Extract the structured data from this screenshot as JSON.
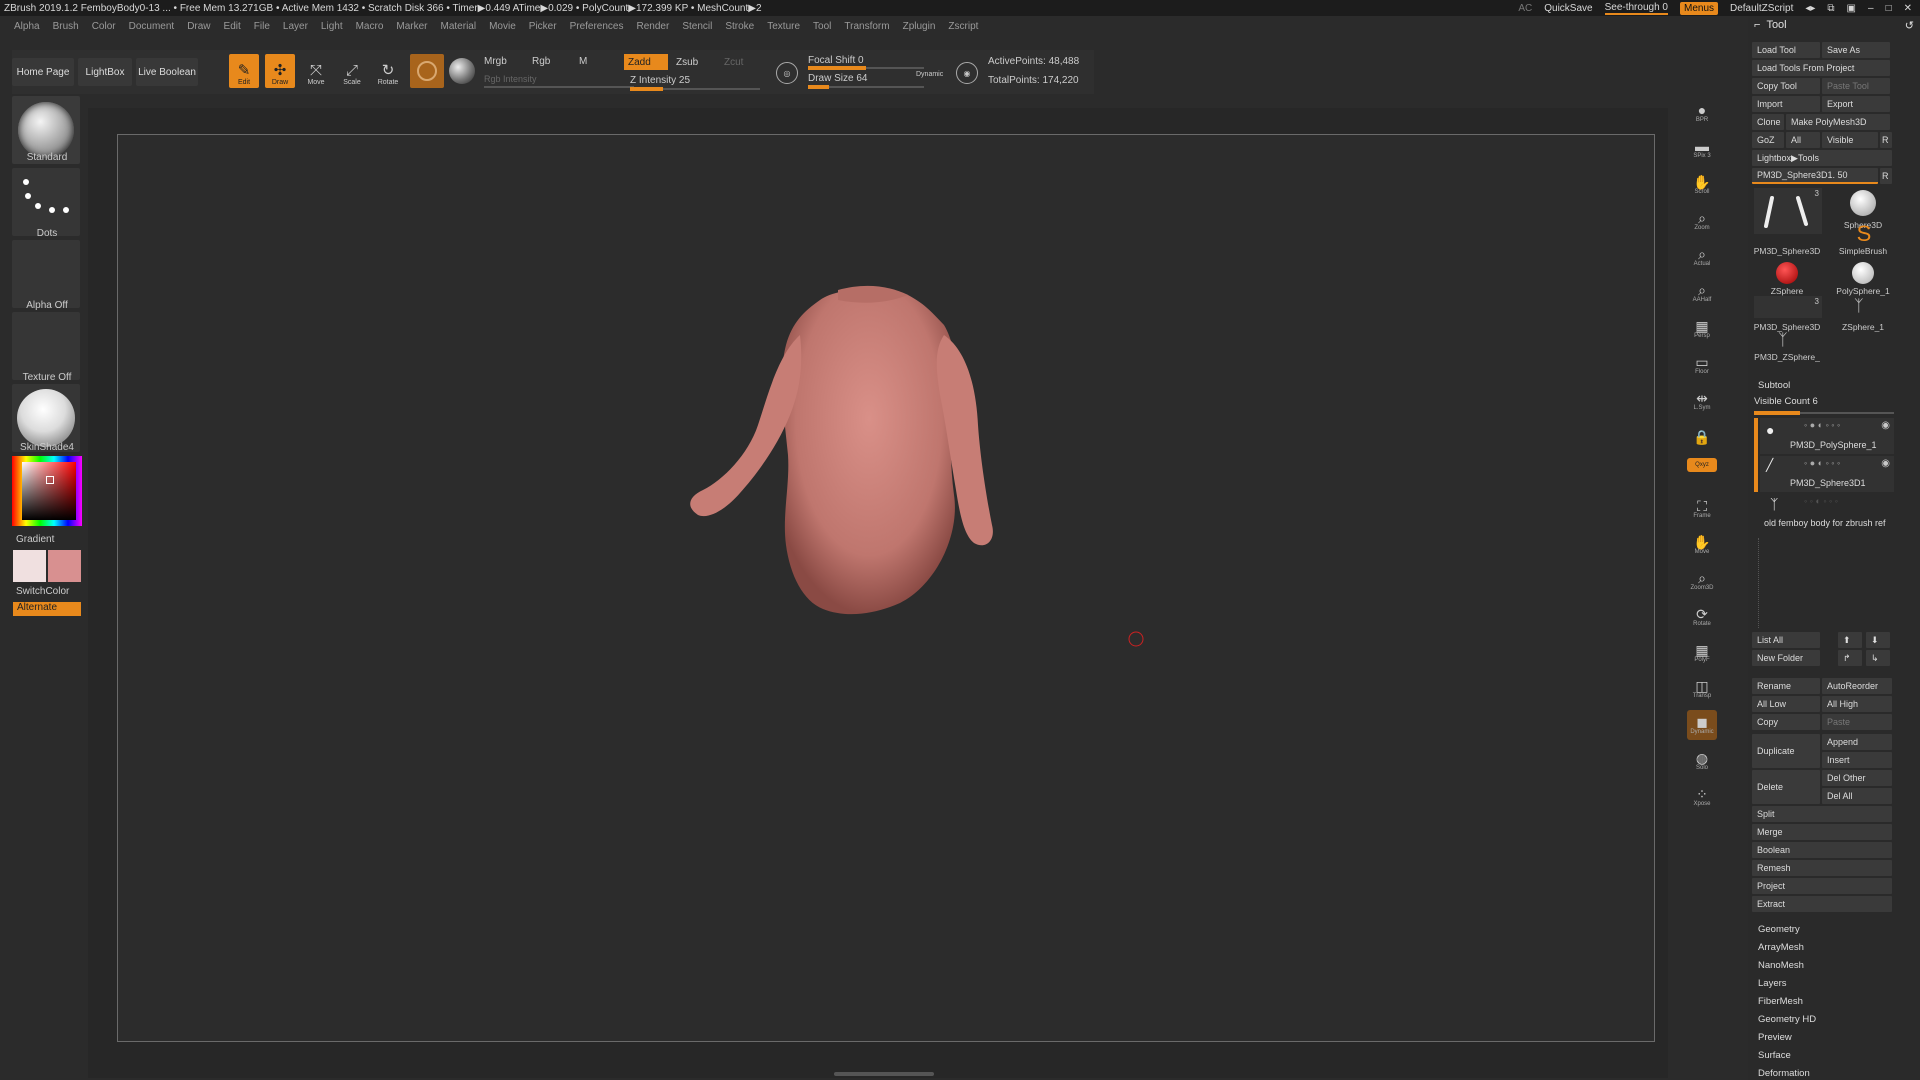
{
  "titlebar": {
    "text": "ZBrush 2019.1.2   FemboyBody0-13   ...  • Free Mem 13.271GB • Active Mem 1432 • Scratch Disk 366 • Timer▶0.449 ATime▶0.029 • PolyCount▶172.399 KP • MeshCount▶2",
    "ac": "AC",
    "quicksave": "QuickSave",
    "seethrough": "See-through  0",
    "menus": "Menus",
    "script": "DefaultZScript"
  },
  "menubar": [
    "Alpha",
    "Brush",
    "Color",
    "Document",
    "Draw",
    "Edit",
    "File",
    "Layer",
    "Light",
    "Macro",
    "Marker",
    "Material",
    "Movie",
    "Picker",
    "Preferences",
    "Render",
    "Stencil",
    "Stroke",
    "Texture",
    "Tool",
    "Transform",
    "Zplugin",
    "Zscript"
  ],
  "toolbar": {
    "home": "Home Page",
    "lightbox": "LightBox",
    "liveboolean": "Live Boolean",
    "edit": "Edit",
    "draw": "Draw",
    "move": "Move",
    "scale": "Scale",
    "rotate": "Rotate",
    "mrgb": "Mrgb",
    "rgb": "Rgb",
    "m": "M",
    "rgb_intensity": "Rgb Intensity",
    "zadd": "Zadd",
    "zsub": "Zsub",
    "zcut": "Zcut",
    "z_intensity": "Z Intensity 25",
    "focal_shift": "Focal Shift 0",
    "draw_size": "Draw Size 64",
    "dynamic": "Dynamic",
    "active_points": "ActivePoints: 48,488",
    "total_points": "TotalPoints: 174,220",
    "z_intensity_level": 0.25,
    "focal_level": 0.5,
    "drawsize_level": 0.18
  },
  "leftpanel": {
    "brush": "Standard",
    "stroke": "Dots",
    "alpha": "Alpha Off",
    "texture": "Texture Off",
    "material": "SkinShade4",
    "gradient": "Gradient",
    "switchcolor": "SwitchColor",
    "alternate": "Alternate"
  },
  "rightstrip": [
    {
      "n": "bpr",
      "l": "BPR"
    },
    {
      "n": "spix",
      "l": "SPix 3"
    },
    {
      "n": "scroll",
      "l": "Scroll"
    },
    {
      "n": "zoom",
      "l": "Zoom"
    },
    {
      "n": "actual",
      "l": "Actual"
    },
    {
      "n": "aahalf",
      "l": "AAHalf"
    },
    {
      "n": "persp",
      "l": "Persp"
    },
    {
      "n": "floor",
      "l": "Floor"
    },
    {
      "n": "lsym",
      "l": "L.Sym"
    },
    {
      "n": "lock",
      "l": ""
    },
    {
      "n": "xyz",
      "l": "Qxyz"
    },
    {
      "n": "frame",
      "l": "Frame"
    },
    {
      "n": "move",
      "l": "Move"
    },
    {
      "n": "zoom3d",
      "l": "Zoom3D"
    },
    {
      "n": "rotate",
      "l": "Rotate"
    },
    {
      "n": "polyf",
      "l": "PolyF"
    },
    {
      "n": "transp",
      "l": "Transp"
    },
    {
      "n": "ghost",
      "l": "Dynamic"
    },
    {
      "n": "solo",
      "l": "Solo"
    },
    {
      "n": "xpose",
      "l": "Xpose"
    }
  ],
  "toolpanel": {
    "title": "Tool",
    "load_tool": "Load Tool",
    "save_as": "Save As",
    "load_from_project": "Load Tools From Project",
    "copy_tool": "Copy Tool",
    "paste_tool": "Paste Tool",
    "import": "Import",
    "export": "Export",
    "clone": "Clone",
    "make_polymesh": "Make PolyMesh3D",
    "goz": "GoZ",
    "all": "All",
    "visible": "Visible",
    "r": "R",
    "lightbox_tools": "Lightbox▶Tools",
    "current_tool": "PM3D_Sphere3D1. 50",
    "thumbs": [
      {
        "label": "PM3D_Sphere3D",
        "count": "3"
      },
      {
        "label": "Sphere3D"
      },
      {
        "label": "SimpleBrush"
      },
      {
        "label": "ZSphere"
      },
      {
        "label": "PolySphere_1"
      },
      {
        "label": "PM3D_Sphere3D",
        "count": "3"
      },
      {
        "label": "ZSphere_1"
      },
      {
        "label": "PM3D_ZSphere_"
      }
    ],
    "subtool": "Subtool",
    "visible_count": "Visible Count 6",
    "subtools": [
      "PM3D_PolySphere_1",
      "PM3D_Sphere3D1",
      "old femboy body for zbrush ref"
    ],
    "list_all": "List All",
    "new_folder": "New Folder",
    "rename": "Rename",
    "autoreorder": "AutoReorder",
    "all_low": "All Low",
    "all_high": "All High",
    "copy": "Copy",
    "paste": "Paste",
    "duplicate": "Duplicate",
    "append": "Append",
    "insert": "Insert",
    "delete": "Delete",
    "del_other": "Del Other",
    "del_all": "Del All",
    "split": "Split",
    "merge": "Merge",
    "boolean": "Boolean",
    "remesh": "Remesh",
    "project": "Project",
    "extract": "Extract",
    "sections": [
      "Geometry",
      "ArrayMesh",
      "NanoMesh",
      "Layers",
      "FiberMesh",
      "Geometry HD",
      "Preview",
      "Surface",
      "Deformation"
    ]
  },
  "colors": {
    "accent": "#e8891c",
    "primary_color": "#f0e0e0",
    "secondary_color": "#d89090",
    "model": "#c98078"
  }
}
